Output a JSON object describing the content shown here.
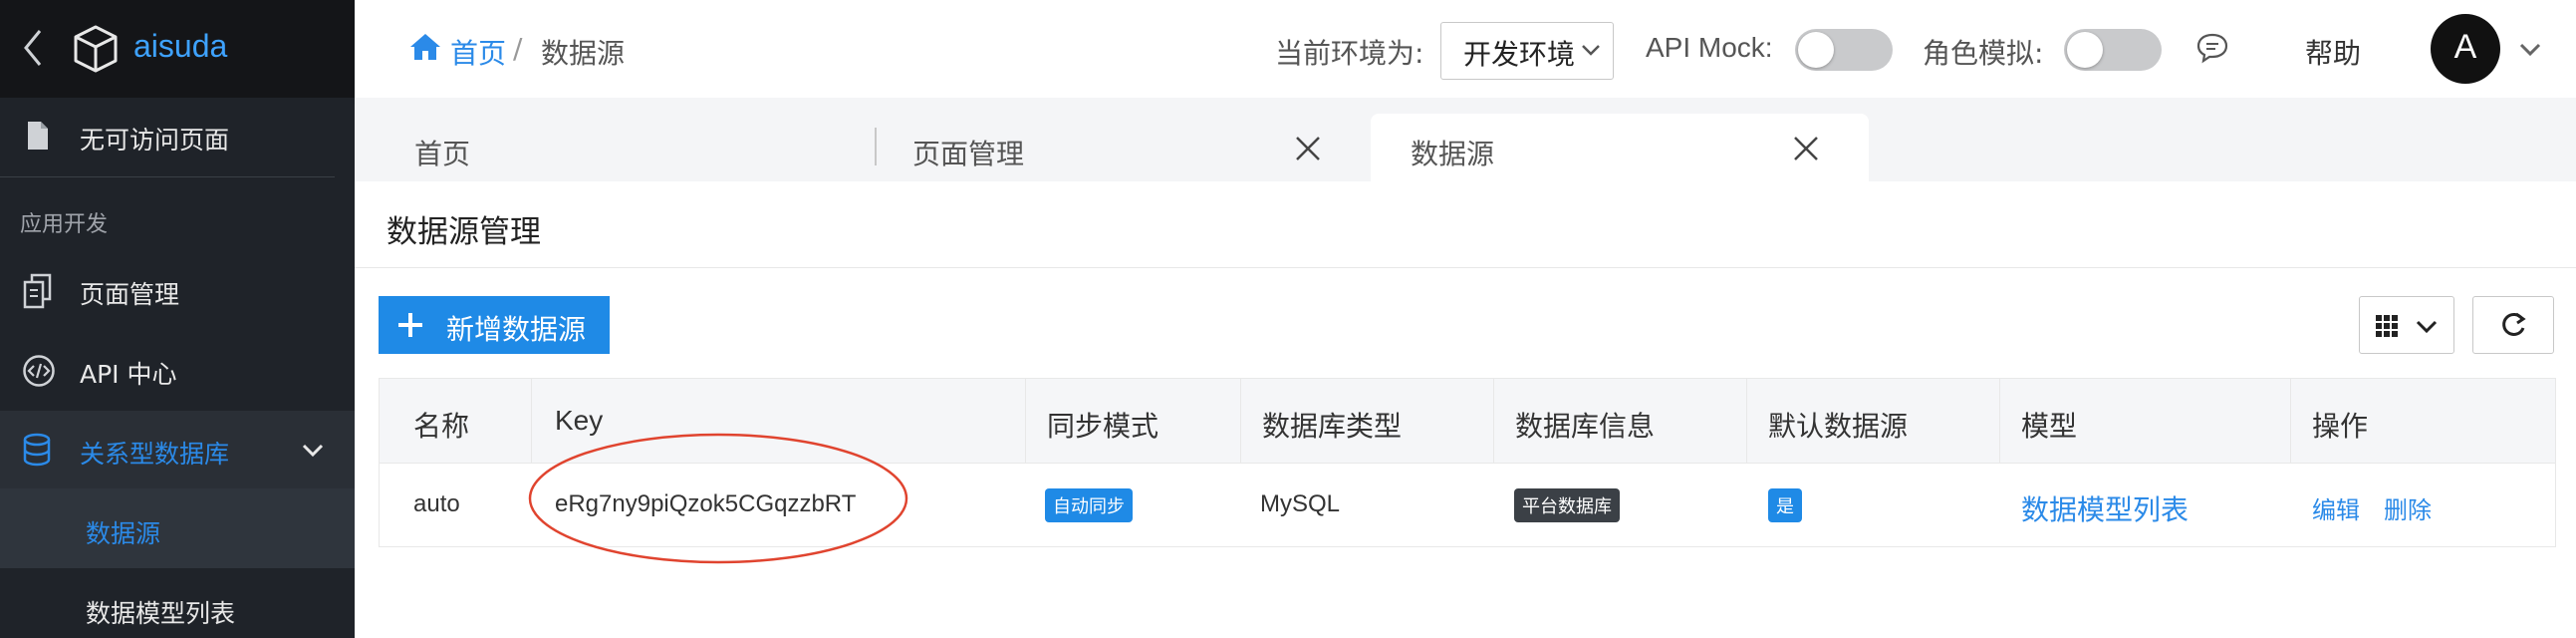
{
  "sidebar": {
    "brand": "aisuda",
    "items": [
      {
        "label": "无可访问页面",
        "icon": "file-icon"
      },
      {
        "label": "页面管理",
        "icon": "pages-icon"
      },
      {
        "label": "API 中心",
        "icon": "code-icon"
      },
      {
        "label": "关系型数据库",
        "icon": "database-icon"
      },
      {
        "label": "数据源"
      },
      {
        "label": "数据模型列表"
      }
    ],
    "section_label": "应用开发"
  },
  "header": {
    "breadcrumb": {
      "home": "首页",
      "separator": "/",
      "current": "数据源"
    },
    "env_label": "当前环境为:",
    "env_value": "开发环境",
    "api_mock_label": "API Mock:",
    "role_sim_label": "角色模拟:",
    "help": "帮助",
    "avatar_letter": "A"
  },
  "tabs": [
    {
      "label": "首页"
    },
    {
      "label": "页面管理"
    },
    {
      "label": "数据源"
    }
  ],
  "page": {
    "title": "数据源管理",
    "add_button": "新增数据源"
  },
  "table": {
    "headers": [
      "名称",
      "Key",
      "同步模式",
      "数据库类型",
      "数据库信息",
      "默认数据源",
      "模型",
      "操作"
    ],
    "row": {
      "name": "auto",
      "key": "eRg7ny9piQzok5CGqzzbRT",
      "sync_mode": "自动同步",
      "db_type": "MySQL",
      "db_info": "平台数据库",
      "default": "是",
      "model_link": "数据模型列表",
      "edit": "编辑",
      "delete": "删除"
    }
  },
  "colors": {
    "accent": "#2b8ae8",
    "sidebar_bg": "#1f2329",
    "active_item": "#2b8ae8",
    "dark_badge": "#3b4046",
    "annotation": "#e0442f"
  }
}
